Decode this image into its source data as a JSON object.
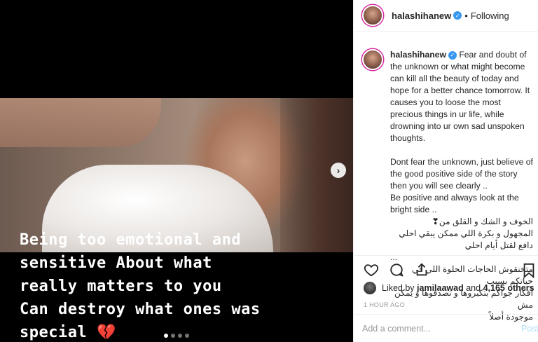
{
  "post": {
    "username": "halashihanew",
    "follow_state": "Following",
    "separator": "•",
    "caption_lines_en": [
      "Fear and doubt of the unknown or what might become can kill all the beauty of today and hope for a better chance tomorrow.",
      "It causes you to loose the most precious things in ur life, while drowning into ur own sad unspoken thoughts.",
      "",
      "Dont fear the unknown, just believe of the good positive side of the story then you will see clearly ..",
      "Be positive and always look at the bright side .."
    ],
    "caption_lines_ar": [
      "الخوف و الشك و القلق من❣",
      "المجهول و بكرة اللي ممكن يبقي احلي دافع لقتل أيام احلي",
      "...",
      "متخنقوش الحاجات الحلوة اللي في حياتكم بسبب",
      "أفكار جواكم بتكبروها و تصدقوها و يمكن مش",
      "موجودة أصلاً"
    ],
    "likes_text": {
      "prefix": "Liked by",
      "user": "jamilaawad",
      "connector": "and",
      "count": "4,165 others"
    },
    "timestamp": "1 HOUR AGO",
    "comment_placeholder": "Add a comment...",
    "post_button": "Post"
  },
  "media": {
    "overlay_lines": [
      "Being too emotional and",
      "sensitive About what",
      "really matters to you",
      "Can destroy what ones was",
      "special 💔"
    ],
    "carousel": {
      "current": 1,
      "total": 4
    },
    "next_icon": "chevron-right-icon"
  },
  "icons": {
    "verified": "verified-badge-icon",
    "like": "heart-icon",
    "comment": "comment-icon",
    "share": "share-icon",
    "save": "bookmark-icon"
  },
  "colors": {
    "verified_blue": "#3897f0",
    "post_button_disabled": "#b2dffc",
    "muted_text": "#999999"
  }
}
